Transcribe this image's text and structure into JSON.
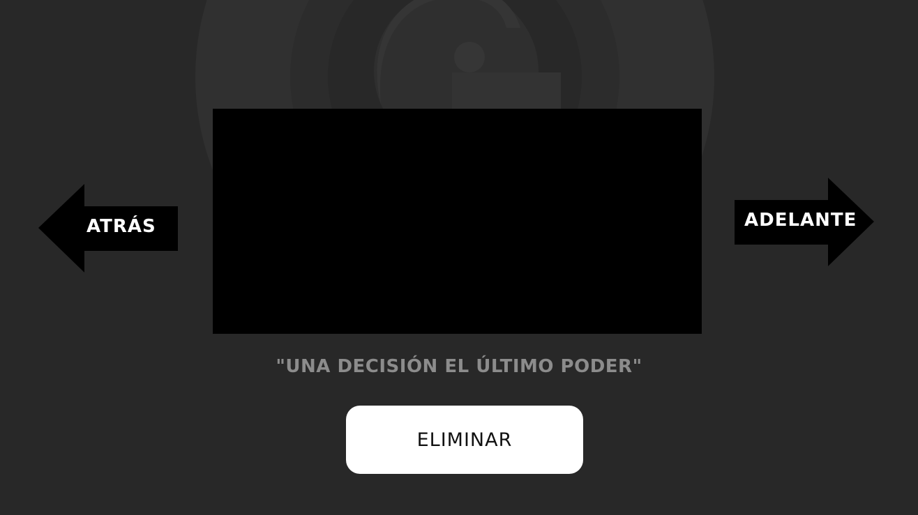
{
  "navigation": {
    "back_label": "ATRÁS",
    "forward_label": "ADELANTE"
  },
  "video": {
    "icon": "background-logo-icon"
  },
  "quote": {
    "text": "\"UNA DECISIÓN EL ÚLTIMO PODER\""
  },
  "actions": {
    "delete_label": "ELIMINAR"
  },
  "colors": {
    "background": "#282828",
    "logo_ring": "#323232",
    "video": "#000000",
    "arrow": "#000000",
    "quote_text": "#8c8c8c",
    "button_bg": "#ffffff"
  }
}
